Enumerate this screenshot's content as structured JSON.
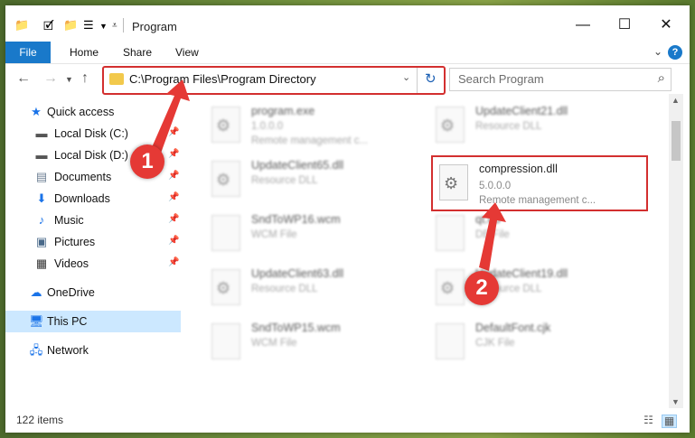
{
  "window": {
    "title": "Program",
    "minimize_icon": "—",
    "maximize_icon": "☐",
    "close_icon": "✕"
  },
  "ribbon": {
    "tabs": [
      "File",
      "Home",
      "Share",
      "View"
    ],
    "help_label": "?"
  },
  "address_bar": {
    "path": "C:\\Program Files\\Program Directory"
  },
  "search": {
    "placeholder": "Search Program"
  },
  "sidebar": {
    "items": [
      {
        "label": "Quick access",
        "icon": "star-icon"
      },
      {
        "label": "Local Disk (C:)",
        "icon": "drive-icon",
        "pinned": true
      },
      {
        "label": "Local Disk (D:)",
        "icon": "drive-icon",
        "pinned": true
      },
      {
        "label": "Documents",
        "icon": "documents-icon",
        "pinned": true
      },
      {
        "label": "Downloads",
        "icon": "download-icon",
        "pinned": true
      },
      {
        "label": "Music",
        "icon": "music-icon",
        "pinned": true
      },
      {
        "label": "Pictures",
        "icon": "pictures-icon",
        "pinned": true
      },
      {
        "label": "Videos",
        "icon": "videos-icon",
        "pinned": true
      },
      {
        "label": "OneDrive",
        "icon": "cloud-icon"
      },
      {
        "label": "This PC",
        "icon": "computer-icon",
        "selected": true
      },
      {
        "label": "Network",
        "icon": "network-icon"
      }
    ]
  },
  "files": [
    {
      "name": "program.exe",
      "line1": "1.0.0.0",
      "line2": "Remote management c...",
      "blurred": true
    },
    {
      "name": "UpdateClient21.dll",
      "line1": "Resource DLL",
      "line2": "",
      "blurred": true
    },
    {
      "name": "UpdateClient65.dll",
      "line1": "Resource DLL",
      "line2": "",
      "blurred": true
    },
    {
      "name": "compression.dll",
      "line1": "5.0.0.0",
      "line2": "Remote management c...",
      "blurred": false
    },
    {
      "name": "SndToWP16.wcm",
      "line1": "WCM File",
      "line2": "",
      "blurred": true
    },
    {
      "name": "qt.db",
      "line1": "DB File",
      "line2": "",
      "blurred": true
    },
    {
      "name": "UpdateClient63.dll",
      "line1": "Resource DLL",
      "line2": "",
      "blurred": true
    },
    {
      "name": "UpdateClient19.dll",
      "line1": "Resource DLL",
      "line2": "",
      "blurred": true
    },
    {
      "name": "SndToWP15.wcm",
      "line1": "WCM File",
      "line2": "",
      "blurred": true
    },
    {
      "name": "DefaultFont.cjk",
      "line1": "CJK File",
      "line2": "",
      "blurred": true
    }
  ],
  "status": {
    "item_count": "122 items"
  },
  "annotations": {
    "step1": "1",
    "step2": "2",
    "color": "#e53935"
  }
}
